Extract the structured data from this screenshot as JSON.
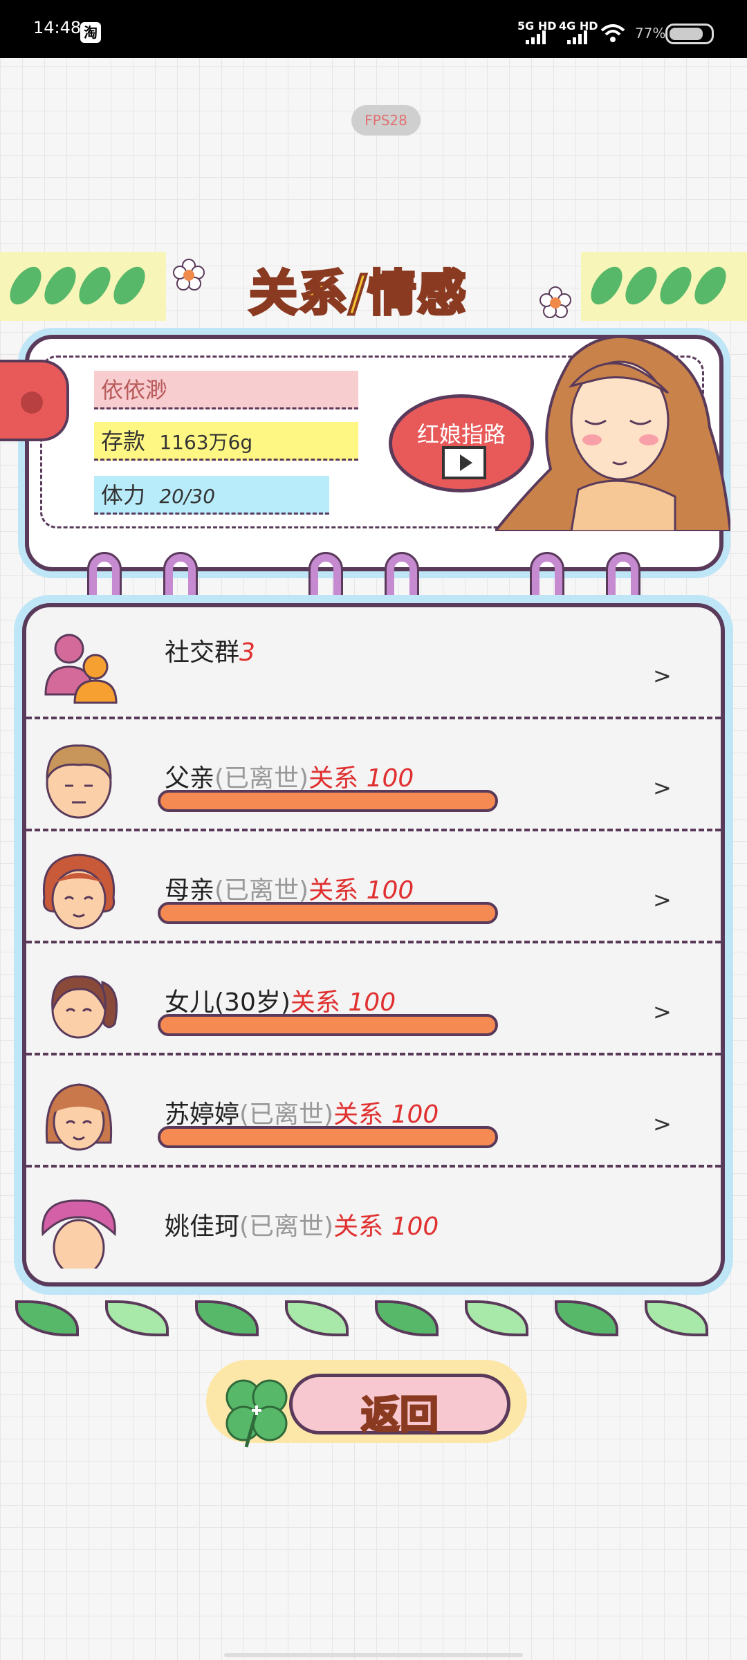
{
  "status_bar": {
    "time": "14:48",
    "taobao_badge": "淘",
    "network_1": "5G HD",
    "network_2": "4G HD",
    "battery_percent": "77%"
  },
  "fps_label": "FPS28",
  "title": "关系/情感",
  "player": {
    "name": "依依渺",
    "savings_label": "存款",
    "savings_value": "1163万6g",
    "stamina_label": "体力",
    "stamina_value": "20/30"
  },
  "matchmaker_button": "红娘指路",
  "relations": [
    {
      "name": "社交群",
      "count": "3",
      "has_bar": false
    },
    {
      "name": "父亲",
      "status": "(已离世)",
      "rel_label": "关系",
      "rel_value": "100",
      "level": 100
    },
    {
      "name": "母亲",
      "status": "(已离世)",
      "rel_label": "关系",
      "rel_value": "100",
      "level": 100
    },
    {
      "name": "女儿",
      "status": "(30岁)",
      "rel_label": "关系",
      "rel_value": "100",
      "level": 100
    },
    {
      "name": "苏婷婷",
      "status": "(已离世)",
      "rel_label": "关系",
      "rel_value": "100",
      "level": 100
    },
    {
      "name": "姚佳珂",
      "status": "(已离世)",
      "rel_label": "关系",
      "rel_value": "100",
      "level": 100
    }
  ],
  "chevron": ">",
  "back_button": "返回",
  "colors": {
    "title_fill": "#f4c430",
    "outline": "#5a3a5a",
    "bar_fill": "#f58a52",
    "accent_red": "#e03030",
    "card_glow": "#bfe6f6"
  }
}
